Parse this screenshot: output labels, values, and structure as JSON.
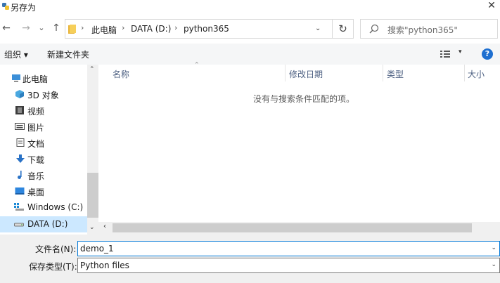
{
  "window": {
    "title": "另存为",
    "close_glyph": "✕"
  },
  "nav": {
    "back": "←",
    "forward": "→",
    "recent": "⌄",
    "up": "↑"
  },
  "address": {
    "crumbs": [
      "此电脑",
      "DATA (D:)",
      "python365"
    ],
    "separator": "›",
    "dropdown": "⌄",
    "refresh": "↻"
  },
  "search": {
    "placeholder": "搜索\"python365\""
  },
  "toolbar": {
    "organize": "组织 ▾",
    "new_folder": "新建文件夹",
    "view_dd": "▾",
    "help": "?"
  },
  "sidebar": {
    "items": [
      {
        "label": "此电脑",
        "icon": "computer-icon"
      },
      {
        "label": "3D 对象",
        "icon": "cube-icon"
      },
      {
        "label": "视频",
        "icon": "film-icon"
      },
      {
        "label": "图片",
        "icon": "picture-icon"
      },
      {
        "label": "文档",
        "icon": "document-icon"
      },
      {
        "label": "下载",
        "icon": "download-icon"
      },
      {
        "label": "音乐",
        "icon": "music-icon"
      },
      {
        "label": "桌面",
        "icon": "desktop-icon"
      },
      {
        "label": "Windows (C:)",
        "icon": "windows-drive-icon"
      },
      {
        "label": "DATA (D:)",
        "icon": "drive-icon"
      }
    ],
    "selected": "DATA (D:)",
    "scroll_up": "⌃",
    "scroll_down": "⌄"
  },
  "filelist": {
    "columns": [
      "名称",
      "修改日期",
      "类型",
      "大小"
    ],
    "sort_arrow": "⌃",
    "empty_message": "没有与搜索条件匹配的项。",
    "hscroll_left": "‹"
  },
  "bottom": {
    "filename_label": "文件名(N):",
    "filename_value": "demo_1",
    "filetype_label": "保存类型(T):",
    "filetype_value": "Python files",
    "dropdown": "⌄"
  },
  "colors": {
    "accent": "#0078d7",
    "selected_bg": "#cce8ff",
    "help_bg": "#1e6fd0"
  }
}
